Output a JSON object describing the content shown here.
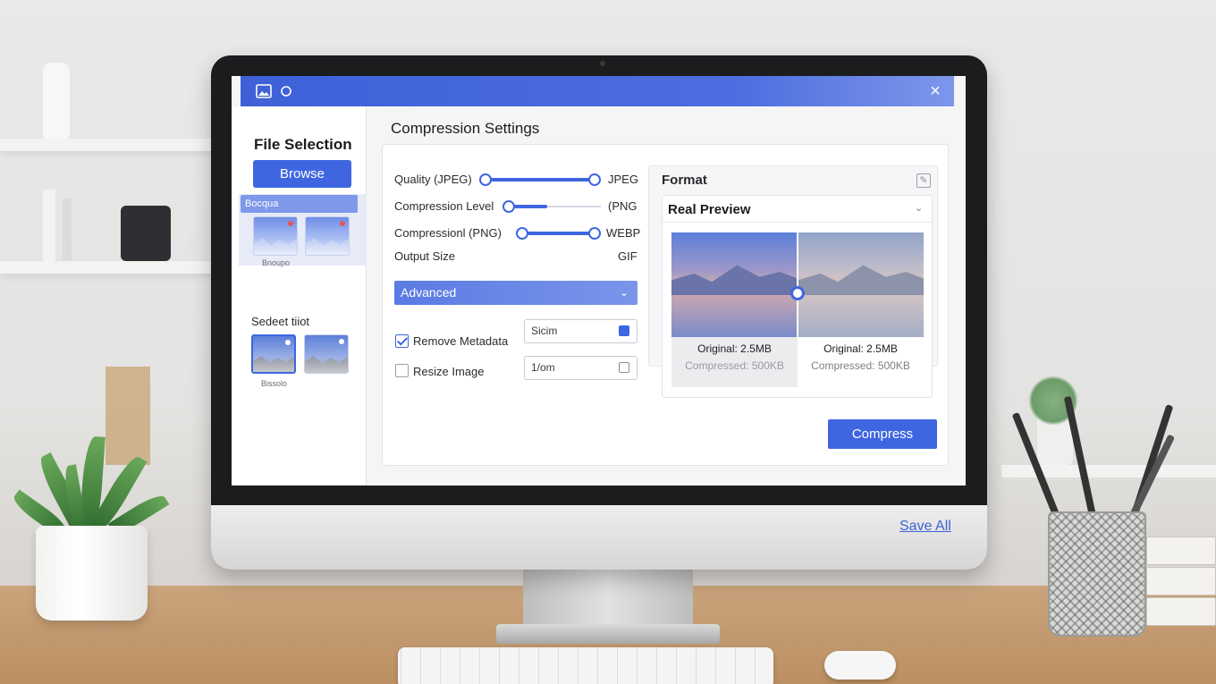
{
  "colors": {
    "accent": "#3f66e0",
    "titlebar": "#4c6ee0",
    "link": "#3d62d6"
  },
  "window": {
    "title_icons": [
      "image-icon",
      "circle-icon"
    ],
    "close_icon": "×"
  },
  "sidebar": {
    "title": "File Selection",
    "browse_label": "Browse",
    "group_label": "Bocqua",
    "group_caption": "Bnoupo",
    "selected_heading": "Sedeet tiiot",
    "selected_caption": "Bissolo"
  },
  "main": {
    "title": "Compression Settings",
    "rows": [
      {
        "label": "Quality (JPEG)",
        "right": "JPEG",
        "slider_start": 0.0,
        "slider_end": 1.0
      },
      {
        "label": "Compression Level",
        "right": "(PNG",
        "slider_start": 0.0,
        "slider_end": 0.45
      },
      {
        "label": "Compressionl (PNG)",
        "right": "WEBP",
        "slider_start": 0.0,
        "slider_end": 1.0
      },
      {
        "label": "Output Size",
        "right": "GIF"
      }
    ],
    "advanced_label": "Advanced",
    "advanced_chevron": "⌄",
    "options": [
      {
        "label": "Remove Metadata",
        "checked": true,
        "field_value": "Sicim"
      },
      {
        "label": "Resize Image",
        "checked": false,
        "field_value": "1/om"
      }
    ],
    "compress_label": "Compress"
  },
  "preview": {
    "format_title": "Format",
    "edit_icon": "✎",
    "title": "Real Preview",
    "chevron": "⌄",
    "left": {
      "original": "Original: 2.5MB",
      "compressed": "Compressed: 500KB"
    },
    "right": {
      "original": "Original: 2.5MB",
      "compressed": "Compressed: 500KB"
    }
  },
  "footer": {
    "save_all": "Save All"
  }
}
